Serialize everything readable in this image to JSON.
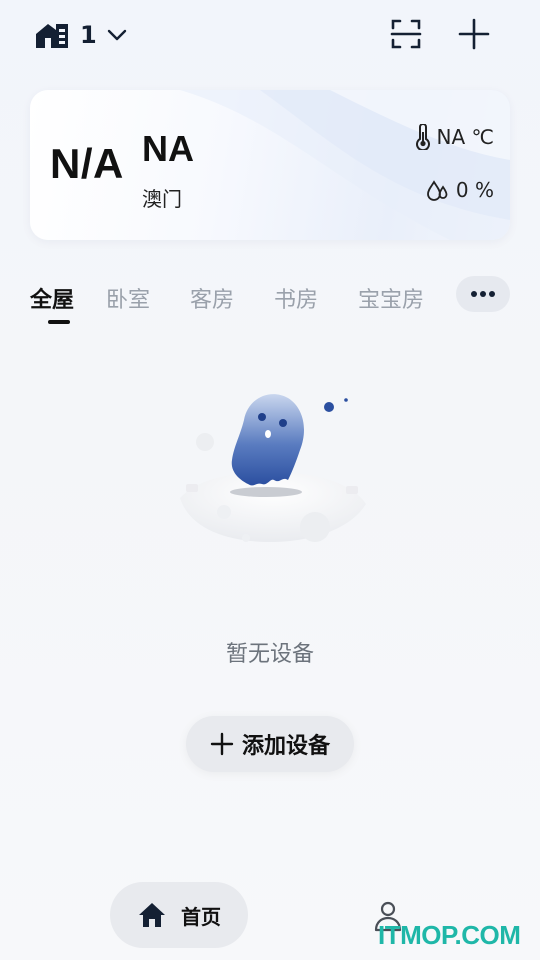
{
  "header": {
    "home_name": "1",
    "icons": {
      "home_switch": "house-icon",
      "dropdown": "chevron-down-icon",
      "scan": "scan-icon",
      "add": "plus-icon"
    }
  },
  "weather": {
    "aqi": "N/A",
    "condition": "NA",
    "city": "澳门",
    "temperature": "NA ℃",
    "humidity": "0 %",
    "icons": {
      "temperature": "thermometer-icon",
      "humidity": "droplets-icon"
    }
  },
  "rooms": {
    "tabs": [
      {
        "label": "全屋",
        "active": true
      },
      {
        "label": "卧室",
        "active": false
      },
      {
        "label": "客房",
        "active": false
      },
      {
        "label": "书房",
        "active": false
      },
      {
        "label": "宝宝房",
        "active": false
      }
    ],
    "more_icon": "more-dots-icon"
  },
  "empty_state": {
    "message": "暂无设备",
    "add_button_label": "添加设备",
    "illustration": "ghost-illustration"
  },
  "bottom_nav": {
    "items": [
      {
        "label": "首页",
        "icon": "home-icon",
        "active": true
      },
      {
        "label": "",
        "icon": "person-icon",
        "active": false
      }
    ]
  },
  "watermark": "ITMOP.COM",
  "colors": {
    "accent_dark": "#142033",
    "ghost_blue": "#2b4fa0",
    "inactive_tab": "#9aa1ab",
    "watermark": "#1fb7a8"
  }
}
